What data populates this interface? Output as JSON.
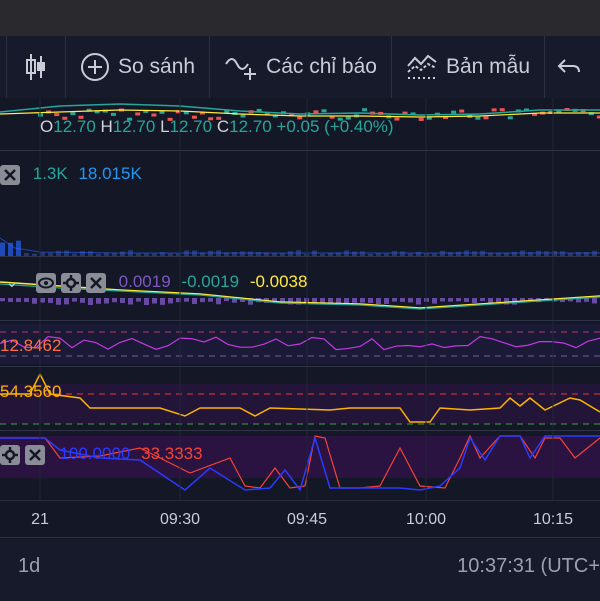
{
  "toolbar": {
    "candle_icon": "candlestick-icon",
    "compare_label": "So sánh",
    "indicators_label": "Các chỉ báo",
    "templates_label": "Bản mẫu"
  },
  "price_legend": {
    "o_label": "O",
    "o_value": "12.70",
    "h_label": "H",
    "h_value": "12.70",
    "l_label": "L",
    "l_value": "12.70",
    "c_label": "C",
    "c_value": "12.70",
    "change": "+0.05 (+0.40%)"
  },
  "volume_legend": {
    "v1": "1.3K",
    "v2": "18.015K"
  },
  "macd_legend": {
    "histogram": "0.0019",
    "macd": "-0.0019",
    "signal": "-0.0038"
  },
  "pane4_legend": {
    "value": "12.8462"
  },
  "pane5_legend": {
    "value": "54.3560"
  },
  "pane6_legend": {
    "value1": "100.0000",
    "value2": "33.3333"
  },
  "time_axis": {
    "ticks": [
      "21",
      "09:30",
      "09:45",
      "10:00",
      "10:15"
    ]
  },
  "footer": {
    "interval": "1d",
    "clock": "10:37:31 (UTC+"
  },
  "colors": {
    "background": "#141826",
    "up": "#26a69a",
    "down": "#ef5350",
    "volume": "#2962ff",
    "macd_line": "#26a69a",
    "signal_line": "#ffeb3b",
    "hist": "#7e57c2",
    "pane4_line": "#e040fb",
    "pane5_line": "#ffb300",
    "pane6_blue": "#2a3aff",
    "pane6_red": "#f44336"
  }
}
